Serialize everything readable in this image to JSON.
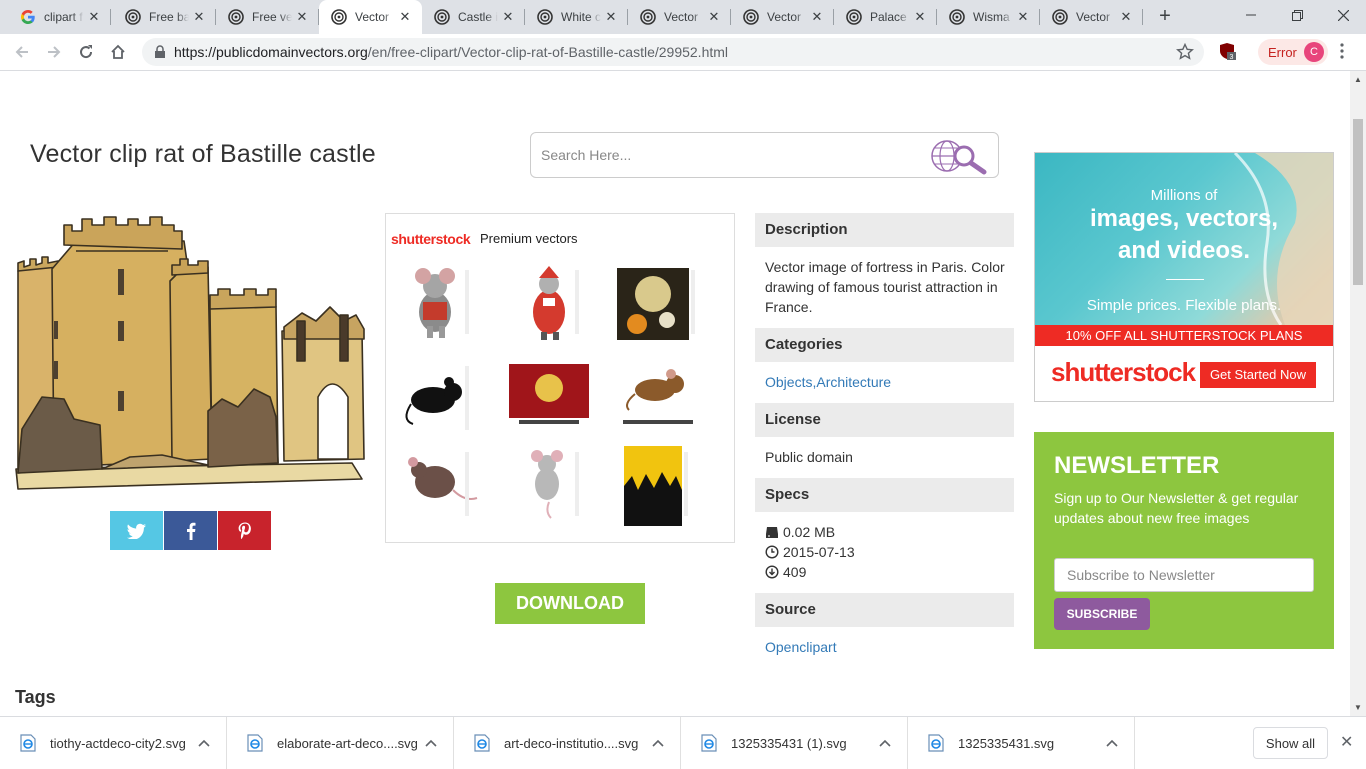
{
  "browser": {
    "tabs": [
      {
        "title": "clipart f",
        "favicon": "google-icon",
        "active": false
      },
      {
        "title": "Free ba",
        "favicon": "pdv-icon",
        "active": false
      },
      {
        "title": "Free ve",
        "favicon": "pdv-icon",
        "active": false
      },
      {
        "title": "Vector",
        "favicon": "pdv-icon",
        "active": true
      },
      {
        "title": "Castle i",
        "favicon": "pdv-icon",
        "active": false
      },
      {
        "title": "White c",
        "favicon": "pdv-icon",
        "active": false
      },
      {
        "title": "Vector",
        "favicon": "pdv-icon",
        "active": false
      },
      {
        "title": "Vector",
        "favicon": "pdv-icon",
        "active": false
      },
      {
        "title": "Palace",
        "favicon": "pdv-icon",
        "active": false
      },
      {
        "title": "Wisma",
        "favicon": "pdv-icon",
        "active": false
      },
      {
        "title": "Vector",
        "favicon": "pdv-icon",
        "active": false
      }
    ],
    "url_host": "https://publicdomainvectors.org",
    "url_path": "/en/free-clipart/Vector-clip-rat-of-Bastille-castle/29952.html",
    "extension_badge": "3",
    "error_label": "Error",
    "profile_initial": "C"
  },
  "page": {
    "title": "Vector clip rat of Bastille castle",
    "search_placeholder": "Search Here...",
    "shutterstock_logo": "shutterstock",
    "premium_label": "Premium vectors",
    "download_label": "DOWNLOAD",
    "tags_heading": "Tags",
    "share": [
      {
        "name": "twitter",
        "color": "#55c7e4"
      },
      {
        "name": "facebook",
        "color": "#3b5998"
      },
      {
        "name": "pinterest",
        "color": "#c8232c"
      }
    ]
  },
  "info": {
    "description_label": "Description",
    "description_text": "Vector image of fortress in Paris. Color drawing of famous tourist attraction in France.",
    "categories_label": "Categories",
    "categories_text": "Objects,Architecture",
    "license_label": "License",
    "license_text": "Public domain",
    "specs_label": "Specs",
    "size": "0.02 MB",
    "date": "2015-07-13",
    "downloads": "409",
    "source_label": "Source",
    "source_text": "Openclipart"
  },
  "ad": {
    "line1": "Millions of",
    "line2": "images, vectors,",
    "line3": "and videos.",
    "line4": "Simple prices. Flexible plans.",
    "offer": "10% OFF ALL SHUTTERSTOCK PLANS",
    "logo": "shutterstock",
    "cta": "Get Started Now"
  },
  "newsletter": {
    "heading": "NEWSLETTER",
    "desc": "Sign up to Our Newsletter & get regular updates about new free images",
    "placeholder": "Subscribe to Newsletter",
    "button": "SUBSCRIBE"
  },
  "downloads_bar": {
    "items": [
      "tiothy-actdeco-city2.svg",
      "elaborate-art-deco....svg",
      "art-deco-institutio....svg",
      "1325335431 (1).svg",
      "1325335431.svg"
    ],
    "show_all": "Show all"
  },
  "colors": {
    "accent_green": "#8dc63f",
    "shutterstock_red": "#ee2b24",
    "subscribe_purple": "#8e5a9e",
    "link_blue": "#337ab7"
  }
}
